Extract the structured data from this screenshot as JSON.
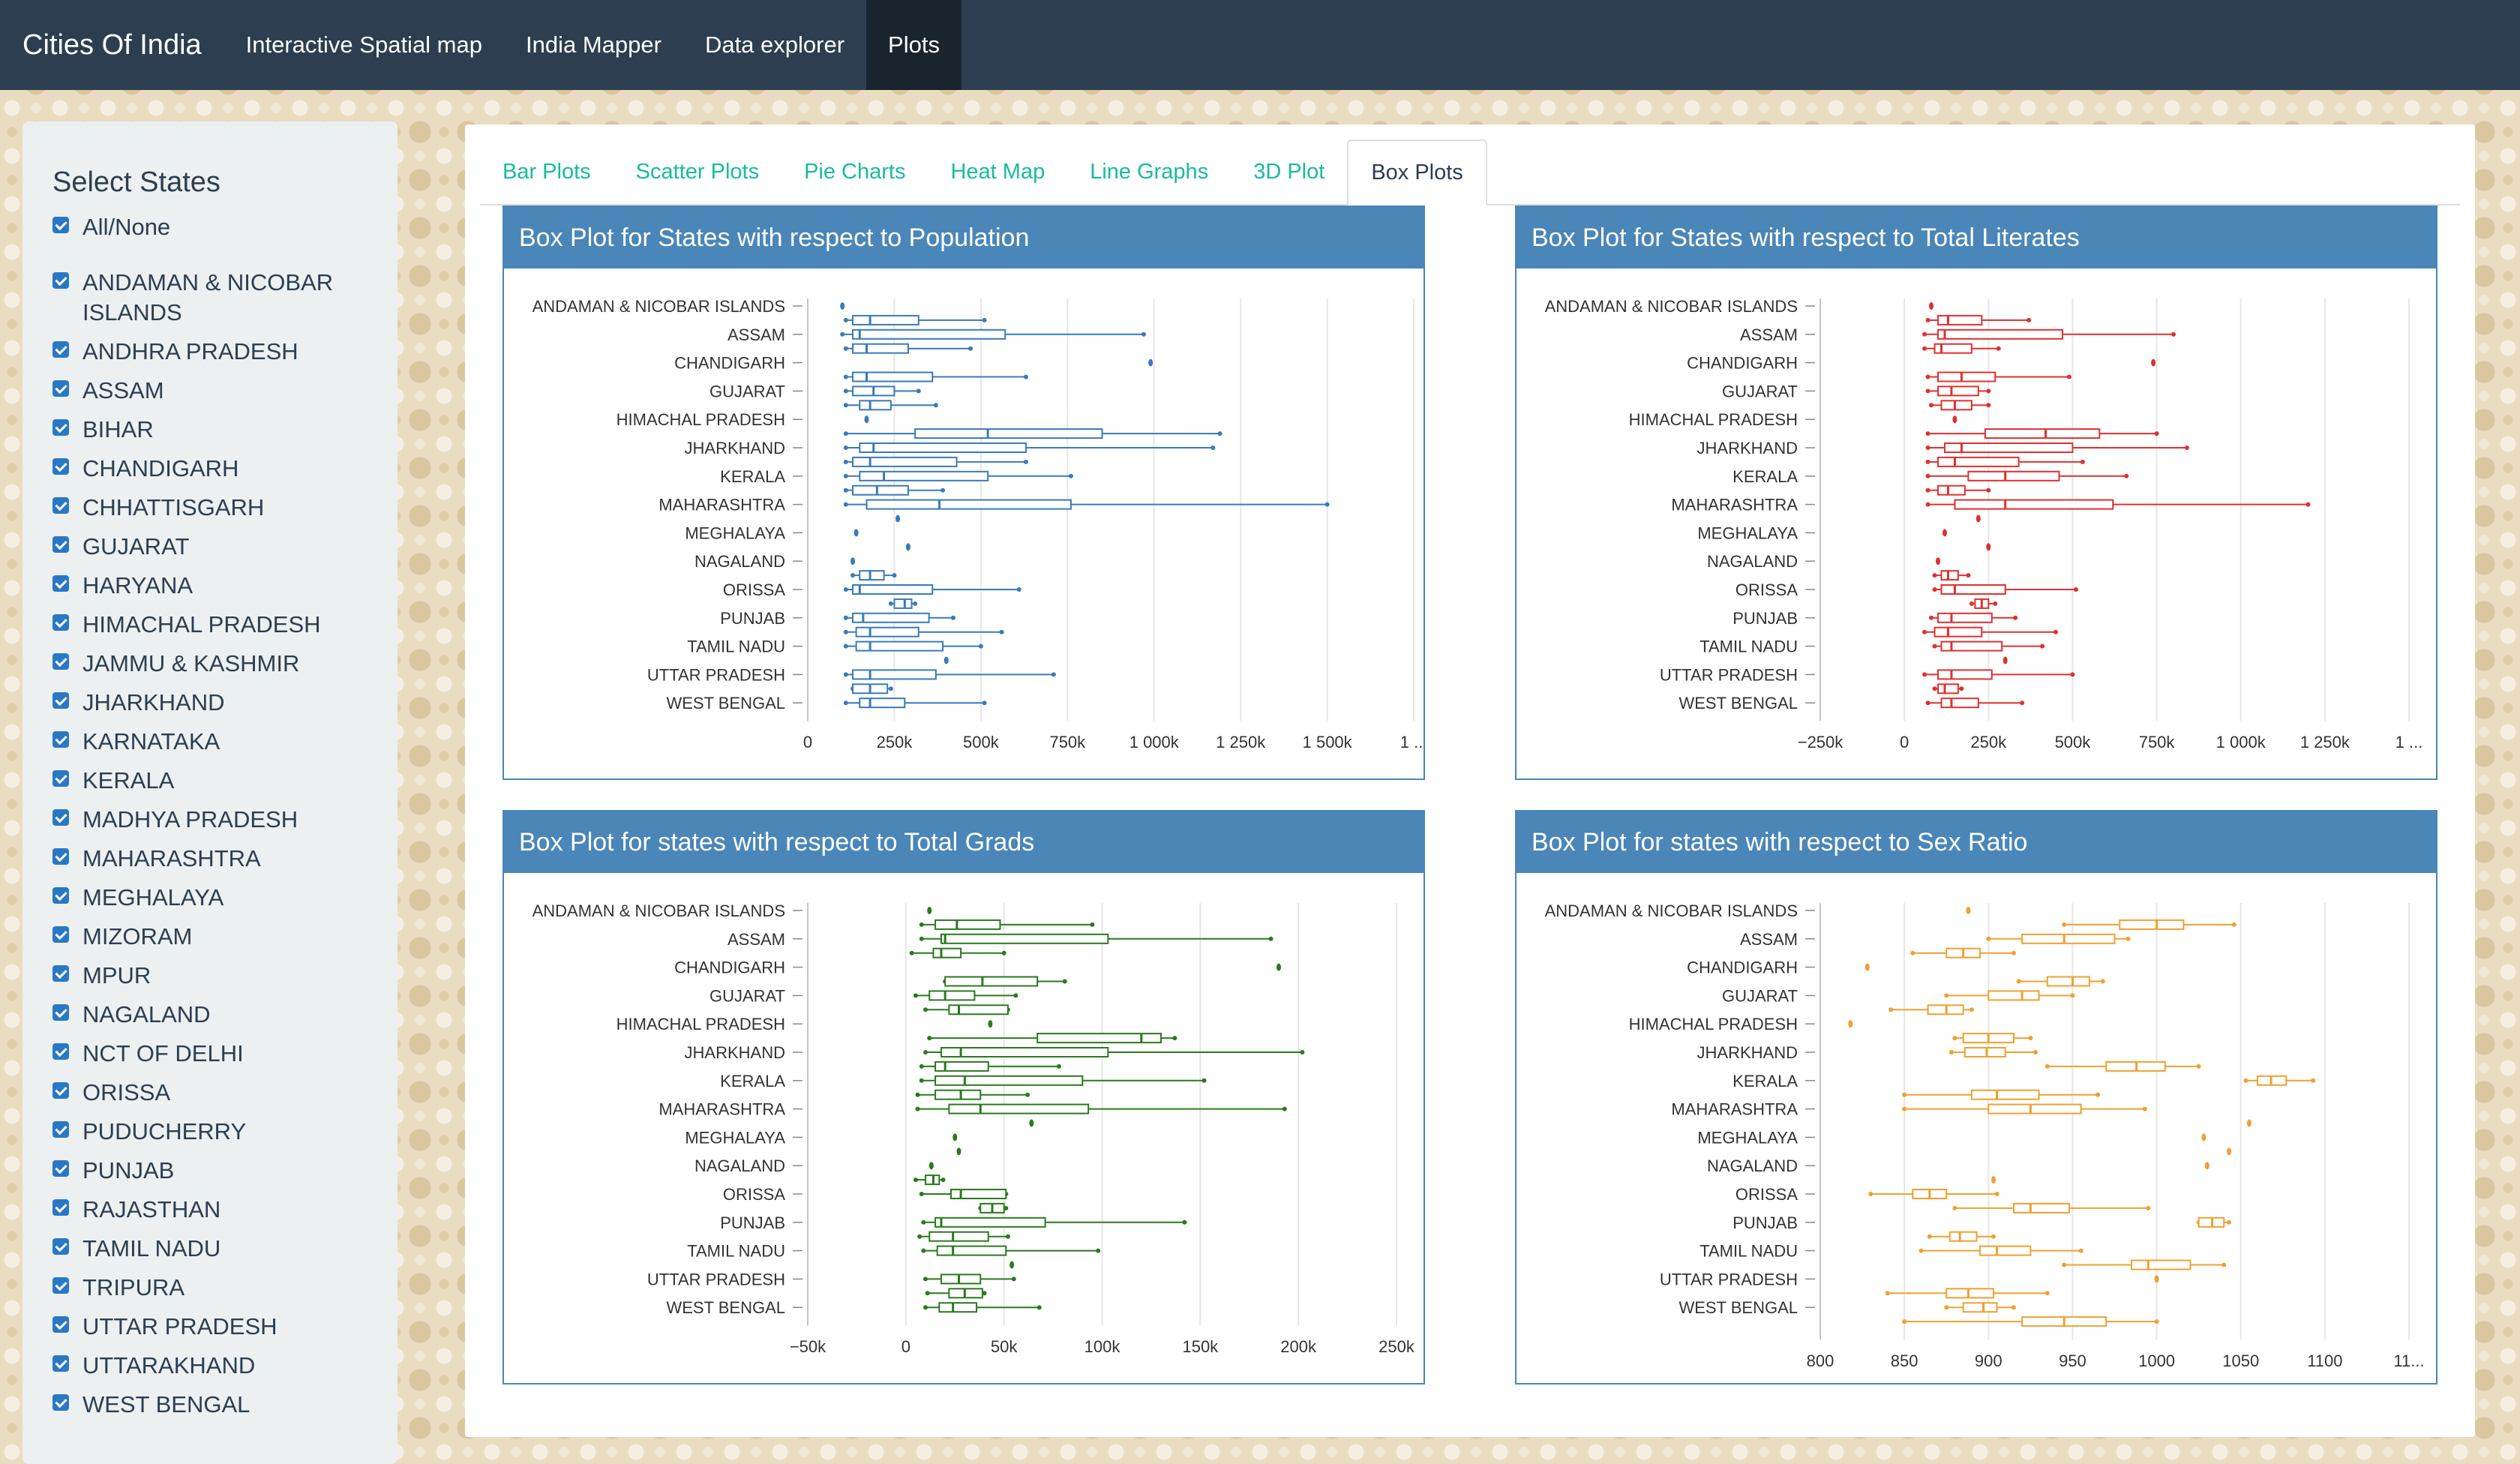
{
  "navbar": {
    "brand": "Cities Of India",
    "items": [
      {
        "label": "Interactive Spatial map"
      },
      {
        "label": "India Mapper"
      },
      {
        "label": "Data explorer"
      },
      {
        "label": "Plots",
        "active": true
      }
    ]
  },
  "sidebar": {
    "title": "Select States",
    "all_label": "All/None",
    "states": [
      "ANDAMAN & NICOBAR ISLANDS",
      "ANDHRA PRADESH",
      "ASSAM",
      "BIHAR",
      "CHANDIGARH",
      "CHHATTISGARH",
      "GUJARAT",
      "HARYANA",
      "HIMACHAL PRADESH",
      "JAMMU & KASHMIR",
      "JHARKHAND",
      "KARNATAKA",
      "KERALA",
      "MADHYA PRADESH",
      "MAHARASHTRA",
      "MEGHALAYA",
      "MIZORAM",
      "MPUR",
      "NAGALAND",
      "NCT OF DELHI",
      "ORISSA",
      "PUDUCHERRY",
      "PUNJAB",
      "RAJASTHAN",
      "TAMIL NADU",
      "TRIPURA",
      "UTTAR PRADESH",
      "UTTARAKHAND",
      "WEST BENGAL"
    ]
  },
  "tabs": [
    {
      "label": "Bar Plots"
    },
    {
      "label": "Scatter Plots"
    },
    {
      "label": "Pie Charts"
    },
    {
      "label": "Heat Map"
    },
    {
      "label": "Line Graphs"
    },
    {
      "label": "3D Plot"
    },
    {
      "label": "Box Plots",
      "active": true
    }
  ],
  "chart_data": [
    {
      "type": "box",
      "title": "Box Plot for States with respect to Population",
      "color": "#3a7ab8",
      "xlim": [
        0,
        1700000
      ],
      "ticks": [
        0,
        250000,
        500000,
        750000,
        1000000,
        1250000,
        1500000
      ],
      "tick_labels": [
        "0",
        "250k",
        "500k",
        "750k",
        "1 000k",
        "1 250k",
        "1 500k",
        "1 ..."
      ],
      "row_labels": [
        "ANDAMAN & NICOBAR ISLANDS",
        "",
        "ASSAM",
        "",
        "CHANDIGARH",
        "",
        "GUJARAT",
        "",
        "HIMACHAL PRADESH",
        "",
        "JHARKHAND",
        "",
        "KERALA",
        "",
        "MAHARASHTRA",
        "",
        "MEGHALAYA",
        "",
        "NAGALAND",
        "",
        "ORISSA",
        "",
        "PUNJAB",
        "",
        "TAMIL NADU",
        "",
        "UTTAR PRADESH",
        "",
        "WEST BENGAL"
      ],
      "boxes": [
        [
          100000,
          100000,
          100000,
          100000,
          100000
        ],
        [
          110000,
          130000,
          180000,
          320000,
          510000
        ],
        [
          100000,
          130000,
          150000,
          570000,
          970000
        ],
        [
          110000,
          130000,
          170000,
          290000,
          470000
        ],
        [
          990000,
          990000,
          990000,
          990000,
          990000
        ],
        [
          110000,
          130000,
          170000,
          360000,
          630000
        ],
        [
          110000,
          130000,
          190000,
          250000,
          320000
        ],
        [
          110000,
          150000,
          180000,
          240000,
          370000
        ],
        [
          170000,
          170000,
          170000,
          170000,
          170000
        ],
        [
          110000,
          310000,
          520000,
          850000,
          1190000
        ],
        [
          110000,
          150000,
          190000,
          630000,
          1170000
        ],
        [
          110000,
          130000,
          180000,
          430000,
          630000
        ],
        [
          110000,
          150000,
          220000,
          520000,
          760000
        ],
        [
          110000,
          130000,
          200000,
          290000,
          390000
        ],
        [
          110000,
          170000,
          380000,
          760000,
          1500000
        ],
        [
          260000,
          260000,
          260000,
          260000,
          260000
        ],
        [
          140000,
          140000,
          140000,
          140000,
          140000
        ],
        [
          290000,
          290000,
          290000,
          290000,
          290000
        ],
        [
          130000,
          130000,
          130000,
          130000,
          130000
        ],
        [
          130000,
          150000,
          180000,
          220000,
          250000
        ],
        [
          110000,
          130000,
          150000,
          360000,
          610000
        ],
        [
          240000,
          250000,
          280000,
          300000,
          310000
        ],
        [
          110000,
          130000,
          160000,
          350000,
          420000
        ],
        [
          110000,
          140000,
          180000,
          320000,
          560000
        ],
        [
          110000,
          140000,
          180000,
          390000,
          500000
        ],
        [
          400000,
          400000,
          400000,
          400000,
          400000
        ],
        [
          110000,
          130000,
          180000,
          370000,
          710000
        ],
        [
          130000,
          130000,
          180000,
          230000,
          240000
        ],
        [
          110000,
          150000,
          180000,
          280000,
          510000
        ]
      ]
    },
    {
      "type": "box",
      "title": "Box Plot for States with respect to Total Literates",
      "color": "#e03030",
      "xlim": [
        -250000,
        1500000
      ],
      "ticks": [
        -250000,
        0,
        250000,
        500000,
        750000,
        1000000,
        1250000
      ],
      "tick_labels": [
        "−250k",
        "0",
        "250k",
        "500k",
        "750k",
        "1 000k",
        "1 250k",
        "1 ..."
      ],
      "row_labels": [
        "ANDAMAN & NICOBAR ISLANDS",
        "",
        "ASSAM",
        "",
        "CHANDIGARH",
        "",
        "GUJARAT",
        "",
        "HIMACHAL PRADESH",
        "",
        "JHARKHAND",
        "",
        "KERALA",
        "",
        "MAHARASHTRA",
        "",
        "MEGHALAYA",
        "",
        "NAGALAND",
        "",
        "ORISSA",
        "",
        "PUNJAB",
        "",
        "TAMIL NADU",
        "",
        "UTTAR PRADESH",
        "",
        "WEST BENGAL"
      ],
      "boxes": [
        [
          80000,
          80000,
          80000,
          80000,
          80000
        ],
        [
          70000,
          100000,
          130000,
          230000,
          370000
        ],
        [
          60000,
          100000,
          120000,
          470000,
          800000
        ],
        [
          60000,
          90000,
          110000,
          200000,
          280000
        ],
        [
          740000,
          740000,
          740000,
          740000,
          740000
        ],
        [
          70000,
          100000,
          170000,
          270000,
          490000
        ],
        [
          70000,
          100000,
          140000,
          220000,
          250000
        ],
        [
          80000,
          110000,
          150000,
          200000,
          250000
        ],
        [
          150000,
          150000,
          150000,
          150000,
          150000
        ],
        [
          70000,
          240000,
          420000,
          580000,
          750000
        ],
        [
          70000,
          120000,
          170000,
          500000,
          840000
        ],
        [
          70000,
          100000,
          150000,
          340000,
          530000
        ],
        [
          70000,
          190000,
          300000,
          460000,
          660000
        ],
        [
          70000,
          100000,
          130000,
          180000,
          250000
        ],
        [
          70000,
          150000,
          300000,
          620000,
          1200000
        ],
        [
          220000,
          220000,
          220000,
          220000,
          220000
        ],
        [
          120000,
          120000,
          120000,
          120000,
          120000
        ],
        [
          250000,
          250000,
          250000,
          250000,
          250000
        ],
        [
          100000,
          100000,
          100000,
          100000,
          100000
        ],
        [
          90000,
          110000,
          130000,
          160000,
          190000
        ],
        [
          90000,
          110000,
          150000,
          300000,
          510000
        ],
        [
          200000,
          210000,
          230000,
          250000,
          270000
        ],
        [
          80000,
          100000,
          140000,
          260000,
          330000
        ],
        [
          60000,
          90000,
          130000,
          230000,
          450000
        ],
        [
          90000,
          110000,
          140000,
          290000,
          410000
        ],
        [
          300000,
          300000,
          300000,
          300000,
          300000
        ],
        [
          60000,
          100000,
          140000,
          260000,
          500000
        ],
        [
          90000,
          100000,
          120000,
          160000,
          170000
        ],
        [
          70000,
          110000,
          140000,
          220000,
          350000
        ]
      ]
    },
    {
      "type": "box",
      "title": "Box Plot for states with respect to Total Grads",
      "color": "#2a7a1e",
      "xlim": [
        -50000,
        250000
      ],
      "ticks": [
        -50000,
        0,
        50000,
        100000,
        150000,
        200000,
        250000
      ],
      "tick_labels": [
        "−50k",
        "0",
        "50k",
        "100k",
        "150k",
        "200k",
        "250k"
      ],
      "row_labels": [
        "ANDAMAN & NICOBAR ISLANDS",
        "",
        "ASSAM",
        "",
        "CHANDIGARH",
        "",
        "GUJARAT",
        "",
        "HIMACHAL PRADESH",
        "",
        "JHARKHAND",
        "",
        "KERALA",
        "",
        "MAHARASHTRA",
        "",
        "MEGHALAYA",
        "",
        "NAGALAND",
        "",
        "ORISSA",
        "",
        "PUNJAB",
        "",
        "TAMIL NADU",
        "",
        "UTTAR PRADESH",
        "",
        "WEST BENGAL"
      ],
      "boxes": [
        [
          12000,
          12000,
          12000,
          12000,
          12000
        ],
        [
          8000,
          15000,
          26000,
          48000,
          95000
        ],
        [
          8000,
          18000,
          20000,
          103000,
          186000
        ],
        [
          3000,
          14000,
          18000,
          28000,
          50000
        ],
        [
          190000,
          190000,
          190000,
          190000,
          190000
        ],
        [
          20000,
          20000,
          39000,
          67000,
          81000
        ],
        [
          5000,
          12000,
          20000,
          35000,
          56000
        ],
        [
          10000,
          22000,
          27000,
          52000,
          52000
        ],
        [
          43000,
          43000,
          43000,
          43000,
          43000
        ],
        [
          12000,
          67000,
          120000,
          130000,
          137000
        ],
        [
          10000,
          18000,
          28000,
          103000,
          202000
        ],
        [
          8000,
          15000,
          20000,
          42000,
          78000
        ],
        [
          8000,
          15000,
          30000,
          90000,
          152000
        ],
        [
          6000,
          15000,
          28000,
          38000,
          62000
        ],
        [
          6000,
          22000,
          38000,
          93000,
          193000
        ],
        [
          64000,
          64000,
          64000,
          64000,
          64000
        ],
        [
          25000,
          25000,
          25000,
          25000,
          25000
        ],
        [
          27000,
          27000,
          27000,
          27000,
          27000
        ],
        [
          13000,
          13000,
          13000,
          13000,
          13000
        ],
        [
          5000,
          10000,
          14000,
          17000,
          19000
        ],
        [
          8000,
          23000,
          28000,
          51000,
          51000
        ],
        [
          38000,
          38000,
          44000,
          50000,
          51000
        ],
        [
          9000,
          15000,
          18000,
          71000,
          142000
        ],
        [
          7000,
          12000,
          24000,
          42000,
          52000
        ],
        [
          9000,
          16000,
          24000,
          51000,
          98000
        ],
        [
          54000,
          54000,
          54000,
          54000,
          54000
        ],
        [
          10000,
          18000,
          27000,
          38000,
          55000
        ],
        [
          11000,
          22000,
          30000,
          39000,
          40000
        ],
        [
          10000,
          17000,
          24000,
          36000,
          68000
        ]
      ]
    },
    {
      "type": "box",
      "title": "Box Plot for states with respect to Sex Ratio",
      "color": "#f0a030",
      "xlim": [
        800,
        1150
      ],
      "ticks": [
        800,
        850,
        900,
        950,
        1000,
        1050,
        1100
      ],
      "tick_labels": [
        "800",
        "850",
        "900",
        "950",
        "1000",
        "1050",
        "1100",
        "11..."
      ],
      "row_labels": [
        "ANDAMAN & NICOBAR ISLANDS",
        "",
        "ASSAM",
        "",
        "CHANDIGARH",
        "",
        "GUJARAT",
        "",
        "HIMACHAL PRADESH",
        "",
        "JHARKHAND",
        "",
        "KERALA",
        "",
        "MAHARASHTRA",
        "",
        "MEGHALAYA",
        "",
        "NAGALAND",
        "",
        "ORISSA",
        "",
        "PUNJAB",
        "",
        "TAMIL NADU",
        "",
        "UTTAR PRADESH",
        "",
        "WEST BENGAL"
      ],
      "boxes": [
        [
          888,
          888,
          888,
          888,
          888
        ],
        [
          945,
          978,
          1000,
          1016,
          1046
        ],
        [
          900,
          920,
          945,
          975,
          983
        ],
        [
          855,
          875,
          885,
          895,
          915
        ],
        [
          828,
          828,
          828,
          828,
          828
        ],
        [
          918,
          935,
          950,
          960,
          968
        ],
        [
          875,
          900,
          920,
          930,
          950
        ],
        [
          842,
          864,
          875,
          885,
          890
        ],
        [
          818,
          818,
          818,
          818,
          818
        ],
        [
          880,
          885,
          900,
          915,
          925
        ],
        [
          878,
          886,
          899,
          910,
          928
        ],
        [
          935,
          970,
          988,
          1005,
          1025
        ],
        [
          1053,
          1060,
          1068,
          1077,
          1093
        ],
        [
          850,
          890,
          905,
          930,
          965
        ],
        [
          850,
          900,
          925,
          955,
          993
        ],
        [
          1055,
          1055,
          1055,
          1055,
          1055
        ],
        [
          1028,
          1028,
          1028,
          1028,
          1028
        ],
        [
          1043,
          1043,
          1043,
          1043,
          1043
        ],
        [
          1030,
          1030,
          1030,
          1030,
          1030
        ],
        [
          903,
          903,
          903,
          903,
          903
        ],
        [
          830,
          855,
          865,
          875,
          905
        ],
        [
          880,
          915,
          925,
          948,
          995
        ],
        [
          1025,
          1025,
          1033,
          1040,
          1043
        ],
        [
          865,
          877,
          883,
          893,
          903
        ],
        [
          860,
          895,
          905,
          925,
          955
        ],
        [
          945,
          985,
          995,
          1020,
          1040
        ],
        [
          1000,
          1000,
          1000,
          1000,
          1000
        ],
        [
          840,
          875,
          888,
          903,
          935
        ],
        [
          875,
          885,
          897,
          905,
          915
        ],
        [
          850,
          920,
          945,
          970,
          1000
        ]
      ]
    }
  ]
}
